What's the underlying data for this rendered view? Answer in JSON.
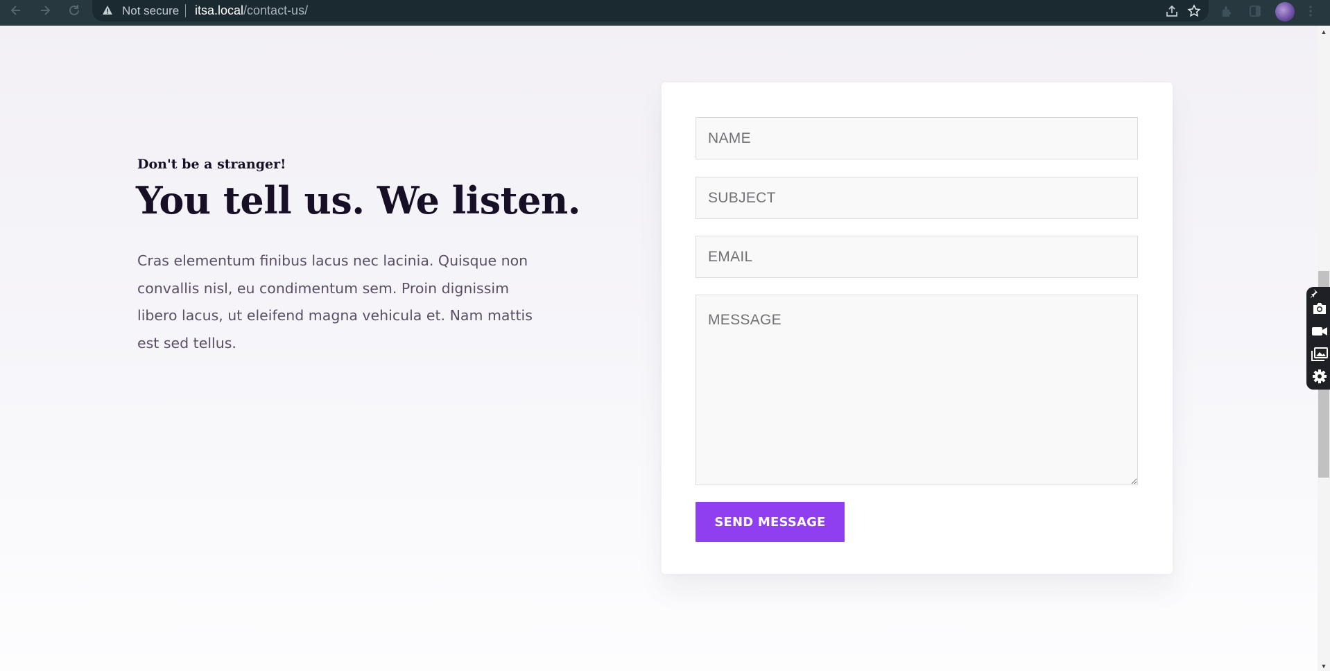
{
  "browser": {
    "security_label": "Not secure",
    "url_host": "itsa.local",
    "url_path": "/contact-us/",
    "icons": [
      "back-icon",
      "forward-icon",
      "reload-icon",
      "warning-icon",
      "share-icon",
      "star-icon",
      "extensions-icon",
      "sidebar-icon",
      "avatar",
      "menu-icon"
    ]
  },
  "contact": {
    "tagline": "Don't be a stranger!",
    "headline": "You tell us. We listen.",
    "description": "Cras elementum finibus lacus nec lacinia. Quisque non convallis nisl, eu condimentum sem. Proin dignissim libero lacus, ut eleifend magna vehicula et. Nam mattis est sed tellus."
  },
  "form": {
    "name": {
      "placeholder": "NAME",
      "value": ""
    },
    "subject": {
      "placeholder": "SUBJECT",
      "value": ""
    },
    "email": {
      "placeholder": "EMAIL",
      "value": ""
    },
    "message": {
      "placeholder": "MESSAGE",
      "value": ""
    },
    "submit_label": "SEND MESSAGE"
  },
  "capture_toolbar": {
    "icons": [
      "pin-icon",
      "camera-icon",
      "video-icon",
      "gallery-icon",
      "gear-icon"
    ]
  },
  "colors": {
    "accent": "#8f3ef0",
    "heading": "#160f26",
    "body_text": "#5a4e66",
    "chrome_bg": "#27383f"
  }
}
